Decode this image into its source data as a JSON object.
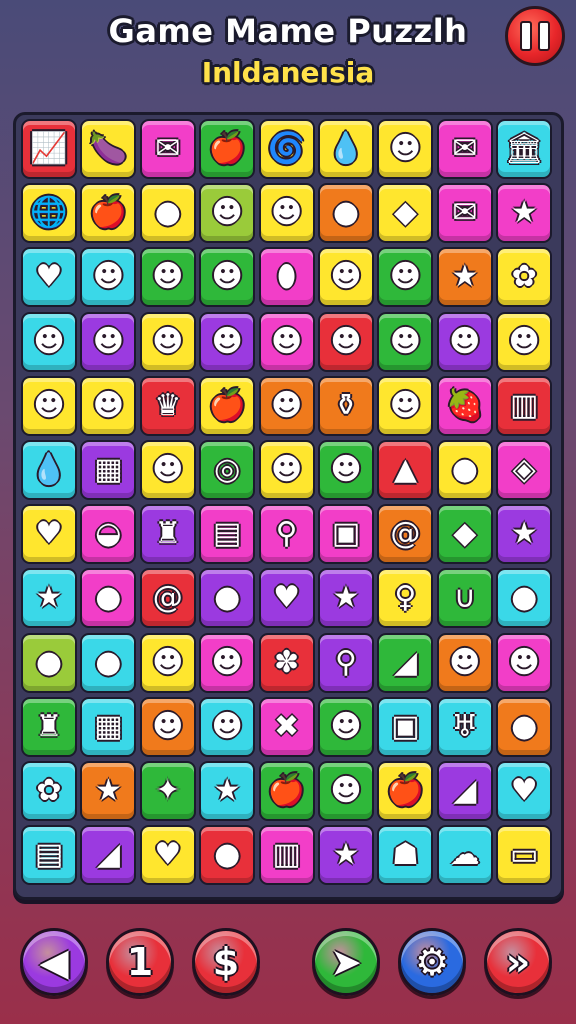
{
  "header": {
    "title": "Game Mame Puzzlh",
    "subtitle": "Inldaneısia"
  },
  "pause_button": {
    "icon": "pause-icon"
  },
  "board": {
    "rows": [
      [
        {
          "icon": "chart-up",
          "glyph": "📈",
          "color": "#e8303a"
        },
        {
          "icon": "eggplant",
          "glyph": "🍆",
          "color": "#ffe62e"
        },
        {
          "icon": "envelope",
          "glyph": "✉",
          "color": "#f23ec8"
        },
        {
          "icon": "apple",
          "glyph": "🍎",
          "color": "#2fb83a"
        },
        {
          "icon": "swirl",
          "glyph": "🌀",
          "color": "#ffe62e"
        },
        {
          "icon": "drop",
          "glyph": "💧",
          "color": "#ffe62e"
        },
        {
          "icon": "blob",
          "glyph": "☻",
          "color": "#ffe62e"
        },
        {
          "icon": "envelope",
          "glyph": "✉",
          "color": "#f23ec8"
        },
        {
          "icon": "temple",
          "glyph": "🏛",
          "color": "#3ad8e8"
        }
      ],
      [
        {
          "icon": "globe",
          "glyph": "🌐",
          "color": "#ffe62e"
        },
        {
          "icon": "apple",
          "glyph": "🍎",
          "color": "#ffe62e"
        },
        {
          "icon": "drop",
          "glyph": "●",
          "color": "#ffe62e"
        },
        {
          "icon": "monster",
          "glyph": "☻",
          "color": "#9acb3a"
        },
        {
          "icon": "monster",
          "glyph": "☻",
          "color": "#ffe62e"
        },
        {
          "icon": "ball",
          "glyph": "●",
          "color": "#f07a1c"
        },
        {
          "icon": "fish",
          "glyph": "◆",
          "color": "#ffe62e"
        },
        {
          "icon": "envelope",
          "glyph": "✉",
          "color": "#f23ec8"
        },
        {
          "icon": "star",
          "glyph": "★",
          "color": "#f23ec8"
        }
      ],
      [
        {
          "icon": "heart",
          "glyph": "♥",
          "color": "#3ad8e8"
        },
        {
          "icon": "pumpkin",
          "glyph": "☻",
          "color": "#3ad8e8"
        },
        {
          "icon": "pumpkin",
          "glyph": "☻",
          "color": "#2fb83a"
        },
        {
          "icon": "pumpkin",
          "glyph": "☻",
          "color": "#2fb83a"
        },
        {
          "icon": "jar",
          "glyph": "⬮",
          "color": "#f23ec8"
        },
        {
          "icon": "smiley",
          "glyph": "☻",
          "color": "#ffe62e"
        },
        {
          "icon": "smiley",
          "glyph": "☻",
          "color": "#2fb83a"
        },
        {
          "icon": "star",
          "glyph": "★",
          "color": "#f07a1c"
        },
        {
          "icon": "flower",
          "glyph": "✿",
          "color": "#ffe62e"
        }
      ],
      [
        {
          "icon": "orange",
          "glyph": "☻",
          "color": "#3ad8e8"
        },
        {
          "icon": "orange",
          "glyph": "☻",
          "color": "#9b3ae0"
        },
        {
          "icon": "orange",
          "glyph": "☻",
          "color": "#ffe62e"
        },
        {
          "icon": "orange",
          "glyph": "☻",
          "color": "#9b3ae0"
        },
        {
          "icon": "orange",
          "glyph": "☻",
          "color": "#f23ec8"
        },
        {
          "icon": "face",
          "glyph": "☻",
          "color": "#e8303a"
        },
        {
          "icon": "smiley",
          "glyph": "☻",
          "color": "#2fb83a"
        },
        {
          "icon": "orange",
          "glyph": "☻",
          "color": "#9b3ae0"
        },
        {
          "icon": "smiley",
          "glyph": "☻",
          "color": "#ffe62e"
        }
      ],
      [
        {
          "icon": "blob",
          "glyph": "☻",
          "color": "#ffe62e"
        },
        {
          "icon": "blob",
          "glyph": "☻",
          "color": "#ffe62e"
        },
        {
          "icon": "crown",
          "glyph": "♛",
          "color": "#e8303a"
        },
        {
          "icon": "apple",
          "glyph": "🍎",
          "color": "#ffe62e"
        },
        {
          "icon": "face",
          "glyph": "☻",
          "color": "#f07a1c"
        },
        {
          "icon": "bottle",
          "glyph": "⚱",
          "color": "#f07a1c"
        },
        {
          "icon": "blob",
          "glyph": "☻",
          "color": "#ffe62e"
        },
        {
          "icon": "strawberry",
          "glyph": "🍓",
          "color": "#f23ec8"
        },
        {
          "icon": "book",
          "glyph": "▥",
          "color": "#e8303a"
        }
      ],
      [
        {
          "icon": "drop",
          "glyph": "💧",
          "color": "#3ad8e8"
        },
        {
          "icon": "basket",
          "glyph": "▦",
          "color": "#9b3ae0"
        },
        {
          "icon": "smiley",
          "glyph": "☻",
          "color": "#ffe62e"
        },
        {
          "icon": "target",
          "glyph": "◎",
          "color": "#2fb83a"
        },
        {
          "icon": "face",
          "glyph": "☻",
          "color": "#ffe62e"
        },
        {
          "icon": "face",
          "glyph": "☻",
          "color": "#2fb83a"
        },
        {
          "icon": "tag",
          "glyph": "▲",
          "color": "#e8303a"
        },
        {
          "icon": "lime",
          "glyph": "●",
          "color": "#ffe62e"
        },
        {
          "icon": "box",
          "glyph": "◈",
          "color": "#f23ec8"
        }
      ],
      [
        {
          "icon": "heart",
          "glyph": "♥",
          "color": "#ffe62e"
        },
        {
          "icon": "bowl",
          "glyph": "◒",
          "color": "#f23ec8"
        },
        {
          "icon": "cake",
          "glyph": "♜",
          "color": "#9b3ae0"
        },
        {
          "icon": "radio",
          "glyph": "▤",
          "color": "#f23ec8"
        },
        {
          "icon": "bike",
          "glyph": "⚲",
          "color": "#f23ec8"
        },
        {
          "icon": "bag",
          "glyph": "▣",
          "color": "#f23ec8"
        },
        {
          "icon": "swirl",
          "glyph": "@",
          "color": "#f07a1c"
        },
        {
          "icon": "fish",
          "glyph": "◆",
          "color": "#2fb83a"
        },
        {
          "icon": "star",
          "glyph": "★",
          "color": "#9b3ae0"
        }
      ],
      [
        {
          "icon": "star",
          "glyph": "★",
          "color": "#3ad8e8"
        },
        {
          "icon": "orange",
          "glyph": "●",
          "color": "#f23ec8"
        },
        {
          "icon": "swirl",
          "glyph": "@",
          "color": "#e8303a"
        },
        {
          "icon": "lemon",
          "glyph": "●",
          "color": "#9b3ae0"
        },
        {
          "icon": "heart",
          "glyph": "♥",
          "color": "#9b3ae0"
        },
        {
          "icon": "star",
          "glyph": "★",
          "color": "#9b3ae0"
        },
        {
          "icon": "bulb",
          "glyph": "♀",
          "color": "#ffe62e"
        },
        {
          "icon": "horseshoe",
          "glyph": "∪",
          "color": "#2fb83a"
        },
        {
          "icon": "mango",
          "glyph": "●",
          "color": "#3ad8e8"
        }
      ],
      [
        {
          "icon": "apple",
          "glyph": "●",
          "color": "#9acb3a"
        },
        {
          "icon": "lollipop",
          "glyph": "●",
          "color": "#3ad8e8"
        },
        {
          "icon": "mug",
          "glyph": "☻",
          "color": "#ffe62e"
        },
        {
          "icon": "face",
          "glyph": "☻",
          "color": "#f23ec8"
        },
        {
          "icon": "leaf",
          "glyph": "✽",
          "color": "#e8303a"
        },
        {
          "icon": "scooter",
          "glyph": "⚲",
          "color": "#9b3ae0"
        },
        {
          "icon": "carrot",
          "glyph": "◢",
          "color": "#2fb83a"
        },
        {
          "icon": "face",
          "glyph": "☻",
          "color": "#f07a1c"
        },
        {
          "icon": "face",
          "glyph": "☻",
          "color": "#f23ec8"
        }
      ],
      [
        {
          "icon": "hammer",
          "glyph": "♜",
          "color": "#2fb83a"
        },
        {
          "icon": "basket",
          "glyph": "▦",
          "color": "#3ad8e8"
        },
        {
          "icon": "face",
          "glyph": "☻",
          "color": "#f07a1c"
        },
        {
          "icon": "face",
          "glyph": "☻",
          "color": "#3ad8e8"
        },
        {
          "icon": "bow",
          "glyph": "✖",
          "color": "#f23ec8"
        },
        {
          "icon": "smiley",
          "glyph": "☻",
          "color": "#2fb83a"
        },
        {
          "icon": "camera",
          "glyph": "▣",
          "color": "#3ad8e8"
        },
        {
          "icon": "tooth",
          "glyph": "♅",
          "color": "#3ad8e8"
        },
        {
          "icon": "balloon",
          "glyph": "●",
          "color": "#f07a1c"
        }
      ],
      [
        {
          "icon": "flower",
          "glyph": "✿",
          "color": "#3ad8e8"
        },
        {
          "icon": "star",
          "glyph": "★",
          "color": "#f07a1c"
        },
        {
          "icon": "scroll",
          "glyph": "✦",
          "color": "#2fb83a"
        },
        {
          "icon": "star",
          "glyph": "★",
          "color": "#3ad8e8"
        },
        {
          "icon": "apple",
          "glyph": "🍎",
          "color": "#2fb83a"
        },
        {
          "icon": "smiley",
          "glyph": "☻",
          "color": "#2fb83a"
        },
        {
          "icon": "apple",
          "glyph": "🍎",
          "color": "#ffe62e"
        },
        {
          "icon": "carrot",
          "glyph": "◢",
          "color": "#9b3ae0"
        },
        {
          "icon": "heart",
          "glyph": "♥",
          "color": "#3ad8e8"
        }
      ],
      [
        {
          "icon": "radio",
          "glyph": "▤",
          "color": "#3ad8e8"
        },
        {
          "icon": "pickle",
          "glyph": "◢",
          "color": "#9b3ae0"
        },
        {
          "icon": "heart",
          "glyph": "♥",
          "color": "#ffe62e"
        },
        {
          "icon": "eggplant",
          "glyph": "●",
          "color": "#e8303a"
        },
        {
          "icon": "book",
          "glyph": "▥",
          "color": "#f23ec8"
        },
        {
          "icon": "star",
          "glyph": "★",
          "color": "#9b3ae0"
        },
        {
          "icon": "ghost",
          "glyph": "☗",
          "color": "#3ad8e8"
        },
        {
          "icon": "cloud",
          "glyph": "☁",
          "color": "#3ad8e8"
        },
        {
          "icon": "cassette",
          "glyph": "▭",
          "color": "#ffe62e"
        }
      ]
    ]
  },
  "bottom_buttons": [
    {
      "name": "back-button",
      "label": "◀",
      "color": "#9b3ae0",
      "icon": "triangle-left-icon"
    },
    {
      "name": "level-button",
      "label": "1",
      "color": "#e8303a",
      "icon": "number-one-icon"
    },
    {
      "name": "shop-button",
      "label": "$",
      "color": "#e8303a",
      "icon": "dollar-icon"
    },
    {
      "name": "hint-button",
      "label": "➤",
      "color": "#2fb83a",
      "icon": "arrow-icon"
    },
    {
      "name": "settings-button",
      "label": "⚙",
      "color": "#2a6ae0",
      "icon": "gear-icon"
    },
    {
      "name": "next-button",
      "label": "»",
      "color": "#e8303a",
      "icon": "chevrons-right-icon"
    }
  ]
}
